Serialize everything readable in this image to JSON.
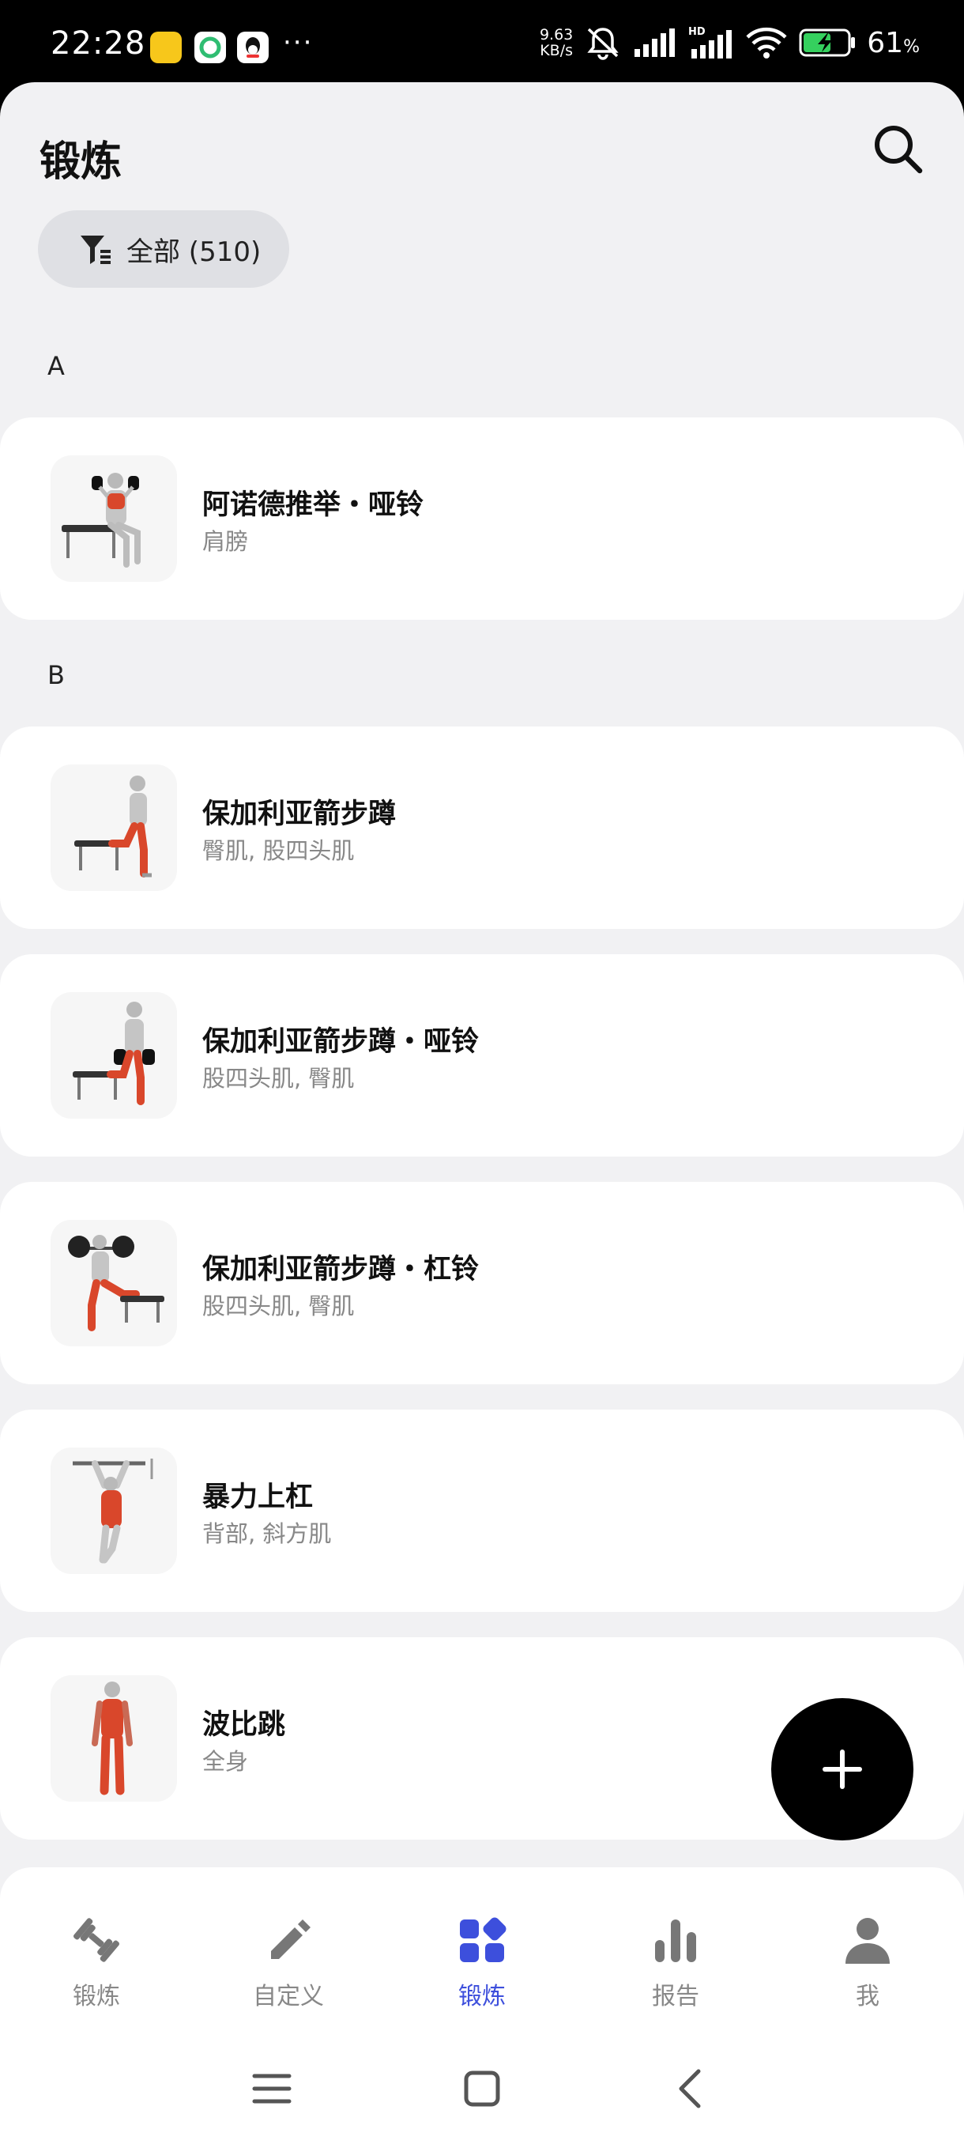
{
  "status_bar": {
    "time": "22:28",
    "more": "···",
    "net_speed_value": "9.63",
    "net_speed_unit": "KB/s",
    "battery_pct": "61",
    "battery_unit": "%"
  },
  "header": {
    "title": "锻炼"
  },
  "filter": {
    "label": "全部 (510)"
  },
  "sections": [
    {
      "letter": "A"
    },
    {
      "letter": "B"
    }
  ],
  "exercises": [
    {
      "name": "阿诺德推举・哑铃",
      "muscles": "肩膀"
    },
    {
      "name": "保加利亚箭步蹲",
      "muscles": "臀肌, 股四头肌"
    },
    {
      "name": "保加利亚箭步蹲・哑铃",
      "muscles": "股四头肌, 臀肌"
    },
    {
      "name": "保加利亚箭步蹲・杠铃",
      "muscles": "股四头肌, 臀肌"
    },
    {
      "name": "暴力上杠",
      "muscles": "背部, 斜方肌"
    },
    {
      "name": "波比跳",
      "muscles": "全身"
    }
  ],
  "bottom_nav": [
    {
      "label": "锻炼",
      "icon": "dumbbell-icon"
    },
    {
      "label": "自定义",
      "icon": "pencil-icon"
    },
    {
      "label": "锻炼",
      "icon": "grid-icon",
      "active": true
    },
    {
      "label": "报告",
      "icon": "bar-chart-icon"
    },
    {
      "label": "我",
      "icon": "person-icon"
    }
  ],
  "colors": {
    "accent": "#3d4fdc",
    "background": "#f1f1f3",
    "muscle_highlight": "#d9472b"
  }
}
